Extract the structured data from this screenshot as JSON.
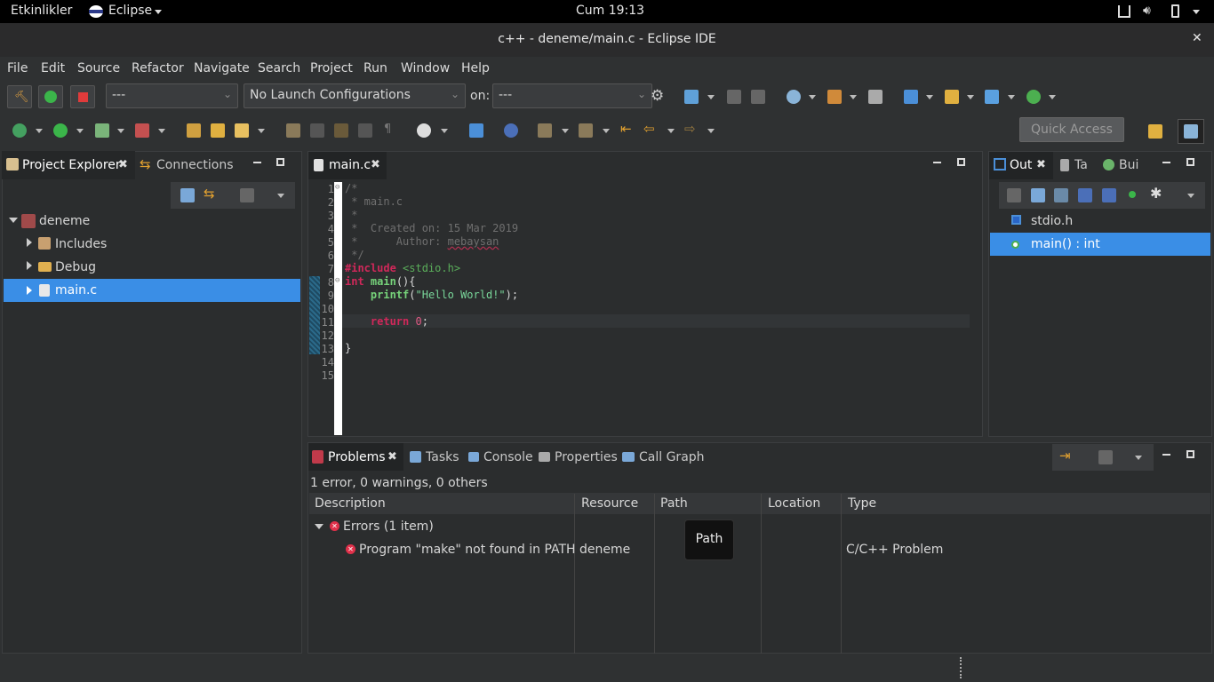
{
  "system_bar": {
    "activities": "Etkinlikler",
    "app": "Eclipse",
    "clock": "Cum 19:13"
  },
  "window": {
    "title": "c++ - deneme/main.c - Eclipse IDE",
    "close": "✕"
  },
  "menu": [
    "File",
    "Edit",
    "Source",
    "Refactor",
    "Navigate",
    "Search",
    "Project",
    "Run",
    "Window",
    "Help"
  ],
  "toolbar": {
    "launch_mode": "---",
    "launch_config": "No Launch Configurations",
    "on_label": "on:",
    "launch_target": "---",
    "quick_access": "Quick Access"
  },
  "project_explorer": {
    "tabs": [
      "Project Explorer",
      "Connections"
    ],
    "tree": [
      {
        "label": "deneme"
      },
      {
        "label": "Includes"
      },
      {
        "label": "Debug"
      },
      {
        "label": "main.c"
      }
    ]
  },
  "editor": {
    "tab": "main.c",
    "line_numbers": [
      "1",
      "2",
      "3",
      "4",
      "5",
      "6",
      "7",
      "8",
      "9",
      "10",
      "11",
      "12",
      "13",
      "14",
      "15"
    ],
    "lines": {
      "l1": "/*",
      "l2": " * main.c",
      "l3": " *",
      "l4": " *  Created on: 15 Mar 2019",
      "l5a": " *      Author: ",
      "l5b": "mebaysan",
      "l6": " */",
      "l7a": "#include ",
      "l7b": "<stdio.h>",
      "l8a": "int ",
      "l8b": "main",
      "l8c": "(){",
      "l9a": "    ",
      "l9b": "printf",
      "l9c": "(",
      "l9d": "\"Hello World!\"",
      "l9e": ");",
      "l11a": "    ",
      "l11b": "return ",
      "l11c": "0",
      "l11d": ";",
      "l13": "}"
    }
  },
  "outline": {
    "tabs": [
      "Out",
      "Ta",
      "Bui"
    ],
    "items": [
      "stdio.h",
      "main() : int"
    ]
  },
  "problems": {
    "tabs": [
      "Problems",
      "Tasks",
      "Console",
      "Properties",
      "Call Graph"
    ],
    "summary": "1 error, 0 warnings, 0 others",
    "columns": [
      "Description",
      "Resource",
      "Path",
      "Location",
      "Type"
    ],
    "group": "Errors (1 item)",
    "row": {
      "description": "Program \"make\" not found in PATH",
      "resource": "deneme",
      "path": "",
      "location": "",
      "type": "C/C++ Problem"
    },
    "tooltip": "Path"
  },
  "colors": {
    "selection": "#3a8ee6",
    "error": "#e0304a"
  }
}
